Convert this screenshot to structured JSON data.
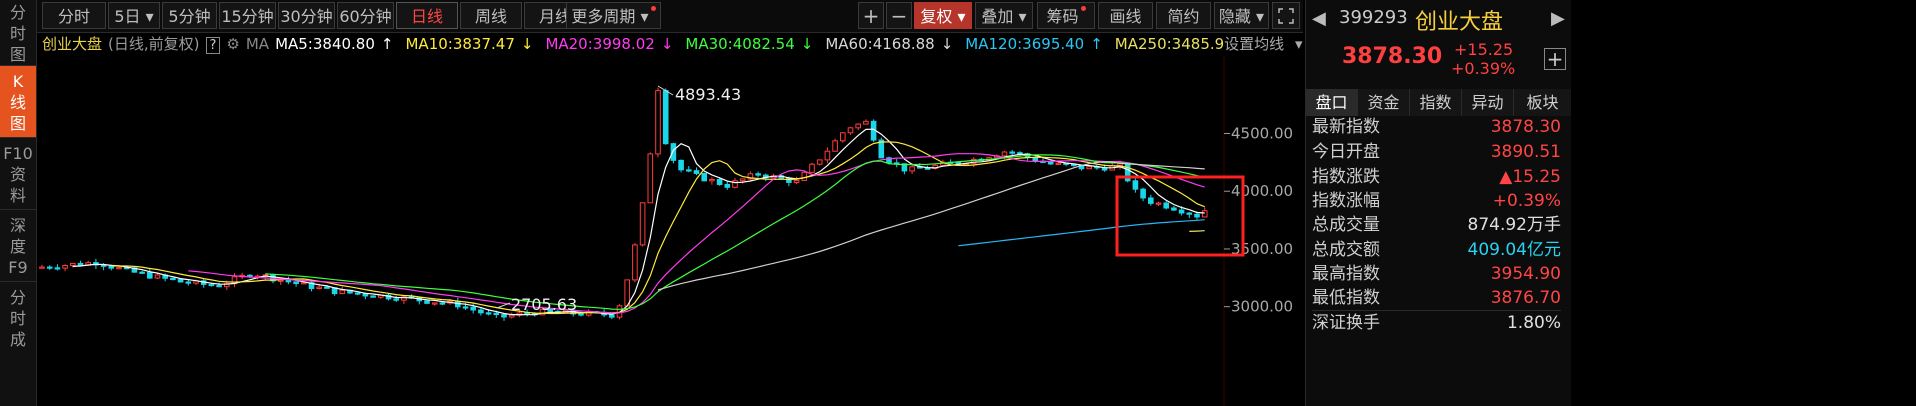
{
  "sidebar": {
    "items": [
      {
        "label": "分\n时\n图"
      },
      {
        "label": "K\n线\n图"
      },
      {
        "label": "F10\n资\n料"
      },
      {
        "label": "深\n度\nF9"
      },
      {
        "label": "分\n时\n成"
      }
    ]
  },
  "toolbar": {
    "periods": [
      "分时",
      "5日",
      "5分钟",
      "15分钟",
      "30分钟",
      "60分钟",
      "日线",
      "周线",
      "月线",
      "更多周期"
    ],
    "active_period": "日线",
    "plus": "+",
    "minus": "−",
    "restore": "复权",
    "overlay": "叠加",
    "chips": "筹码",
    "draw": "画线",
    "simple": "简约",
    "hide": "隐藏"
  },
  "legend": {
    "index_name": "创业大盘",
    "mode": "(日线,前复权)",
    "help": "?",
    "ma_label": "MA",
    "ma5": "MA5:3840.80",
    "ma10": "MA10:3837.47",
    "ma20": "MA20:3998.02",
    "ma30": "MA30:4082.54",
    "ma60": "MA60:4168.88",
    "ma120": "MA120:3695.40",
    "ma250": "MA250:3485.9",
    "settings": "设置均线",
    "arrow_up": "↑",
    "arrow_down": "↓"
  },
  "chart_data": {
    "type": "candlestick",
    "y_ticks": [
      "4500.00",
      "4000.00",
      "3500.00",
      "3000.00"
    ],
    "ylim": [
      2850,
      5050
    ],
    "high_label": "4893.43",
    "low_label": "2705.63",
    "colors": {
      "up": "#ff3b3b",
      "down": "#19d6e8",
      "ma5": "#ffffff",
      "ma10": "#ffea3a",
      "ma20": "#ff3cf0",
      "ma30": "#3dff3d",
      "ma60": "#cfcfcf",
      "ma120": "#29b6f6",
      "ma250": "#e8e060",
      "highlight": "#ff2020"
    }
  },
  "quote": {
    "code": "399293",
    "name": "创业大盘",
    "price": "3878.30",
    "change": "+15.25",
    "change_pct": "+0.39%",
    "add": "+",
    "tabs": [
      "盘口",
      "资金",
      "指数",
      "异动",
      "板块"
    ],
    "rows": [
      {
        "label": "最新指数",
        "value": "3878.30",
        "color": "#ff4545"
      },
      {
        "label": "今日开盘",
        "value": "3890.51",
        "color": "#ff4545"
      },
      {
        "label": "指数涨跌",
        "value": "▲15.25",
        "color": "#ff4545"
      },
      {
        "label": "指数涨幅",
        "value": "+0.39%",
        "color": "#ff4545"
      },
      {
        "label": "总成交量",
        "value": "874.92万手",
        "color": "#e0e0e0"
      },
      {
        "label": "总成交额",
        "value": "409.04亿元",
        "color": "#29d3ee"
      },
      {
        "label": "最高指数",
        "value": "3954.90",
        "color": "#ff4545"
      },
      {
        "label": "最低指数",
        "value": "3876.70",
        "color": "#ff4545"
      },
      {
        "label": "深证换手",
        "value": "1.80%",
        "color": "#e0e0e0"
      }
    ]
  }
}
